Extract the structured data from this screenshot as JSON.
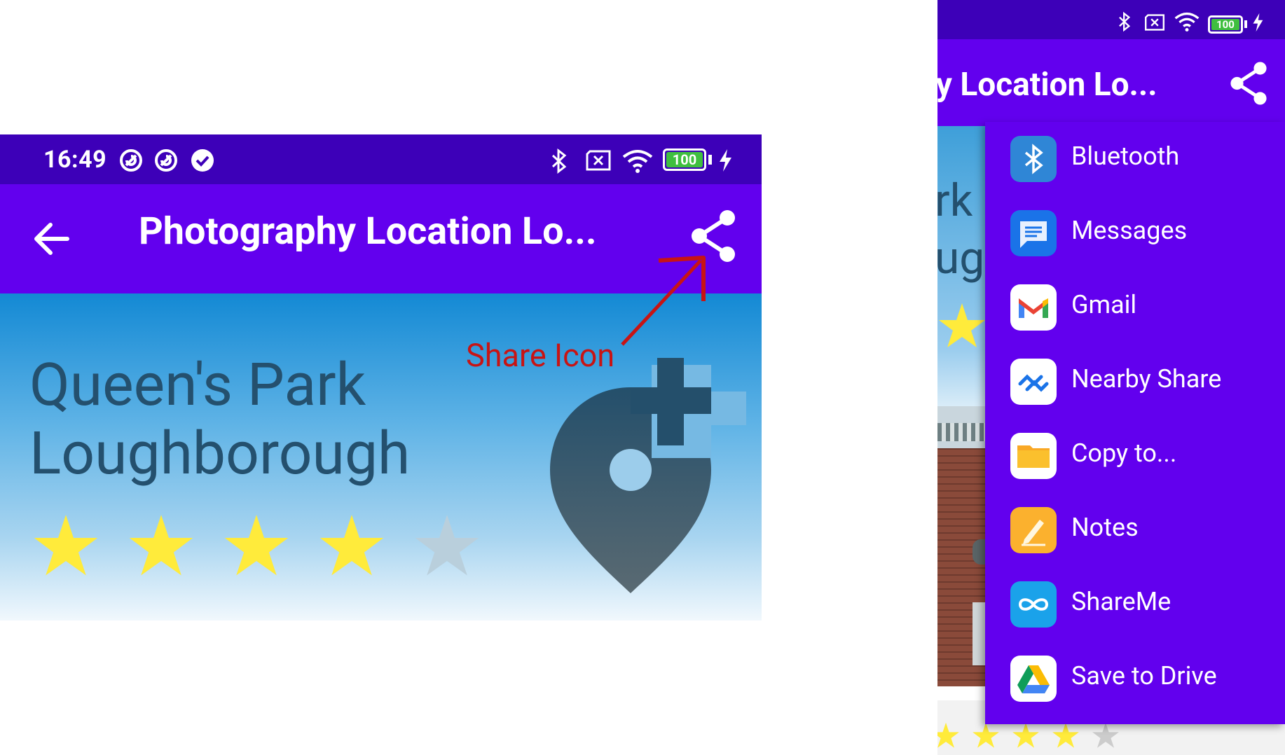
{
  "left_screen": {
    "status_bar": {
      "time": "16:49",
      "battery": "100"
    },
    "app_bar": {
      "title": "Photography Location Lo..."
    },
    "location": {
      "name_line1": "Queen's Park",
      "name_line2": "Loughborough",
      "rating": 4,
      "rating_max": 5
    },
    "annotation": {
      "label": "Share Icon",
      "color": "#c81414"
    }
  },
  "right_screen": {
    "status_bar": {
      "battery": "100"
    },
    "app_bar": {
      "title": "hy Location Lo..."
    },
    "location_fragment": {
      "text_line1": "rk",
      "text_line2": "ug"
    },
    "share_menu": [
      {
        "label": "Bluetooth",
        "icon": "bluetooth-icon"
      },
      {
        "label": "Messages",
        "icon": "messages-icon"
      },
      {
        "label": "Gmail",
        "icon": "gmail-icon"
      },
      {
        "label": "Nearby Share",
        "icon": "nearby-share-icon"
      },
      {
        "label": "Copy to...",
        "icon": "folder-icon"
      },
      {
        "label": "Notes",
        "icon": "notes-icon"
      },
      {
        "label": "ShareMe",
        "icon": "shareme-icon"
      },
      {
        "label": "Save to Drive",
        "icon": "drive-icon"
      }
    ]
  },
  "colors": {
    "status_bar": "#3d00b8",
    "app_bar": "#6200ee",
    "star_filled": "#ffeb3b",
    "star_empty": "#b9cfdc",
    "location_icon": "#2d4f68"
  }
}
